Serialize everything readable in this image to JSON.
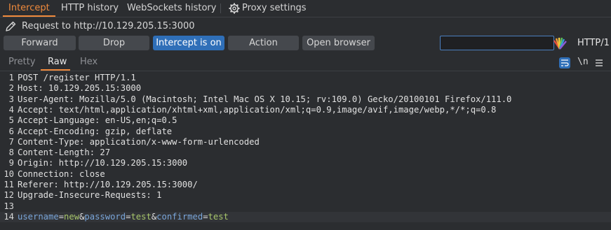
{
  "tabs": [
    {
      "label": "Intercept",
      "active": true
    },
    {
      "label": "HTTP history",
      "active": false
    },
    {
      "label": "WebSockets history",
      "active": false
    },
    {
      "label": "Proxy settings",
      "active": false
    }
  ],
  "request_line": "Request to http://10.129.205.15:3000",
  "toolbar": {
    "forward": "Forward",
    "drop": "Drop",
    "intercept": "Intercept is on",
    "action": "Action",
    "open_browser": "Open browser",
    "search_value": "",
    "http_version": "HTTP/1"
  },
  "view_tabs": [
    "Pretty",
    "Raw",
    "Hex"
  ],
  "view_tab_active": "Raw",
  "editor_tools": {
    "newline_toggle": "\\n"
  },
  "request_lines": [
    "POST /register HTTP/1.1",
    "Host: 10.129.205.15:3000",
    "User-Agent: Mozilla/5.0 (Macintosh; Intel Mac OS X 10.15; rv:109.0) Gecko/20100101 Firefox/111.0",
    "Accept: text/html,application/xhtml+xml,application/xml;q=0.9,image/avif,image/webp,*/*;q=0.8",
    "Accept-Language: en-US,en;q=0.5",
    "Accept-Encoding: gzip, deflate",
    "Content-Type: application/x-www-form-urlencoded",
    "Content-Length: 27",
    "Origin: http://10.129.205.15:3000",
    "Connection: close",
    "Referer: http://10.129.205.15:3000/",
    "Upgrade-Insecure-Requests: 1",
    ""
  ],
  "body_params": [
    {
      "key": "username",
      "value": "new"
    },
    {
      "key": "password",
      "value": "test"
    },
    {
      "key": "confirmed",
      "value": "test"
    }
  ],
  "colors": {
    "accent_orange": "#f08a3c",
    "intercept_blue": "#2f6fb8",
    "param_key": "#7aa6da",
    "param_value": "#a8c66b"
  }
}
